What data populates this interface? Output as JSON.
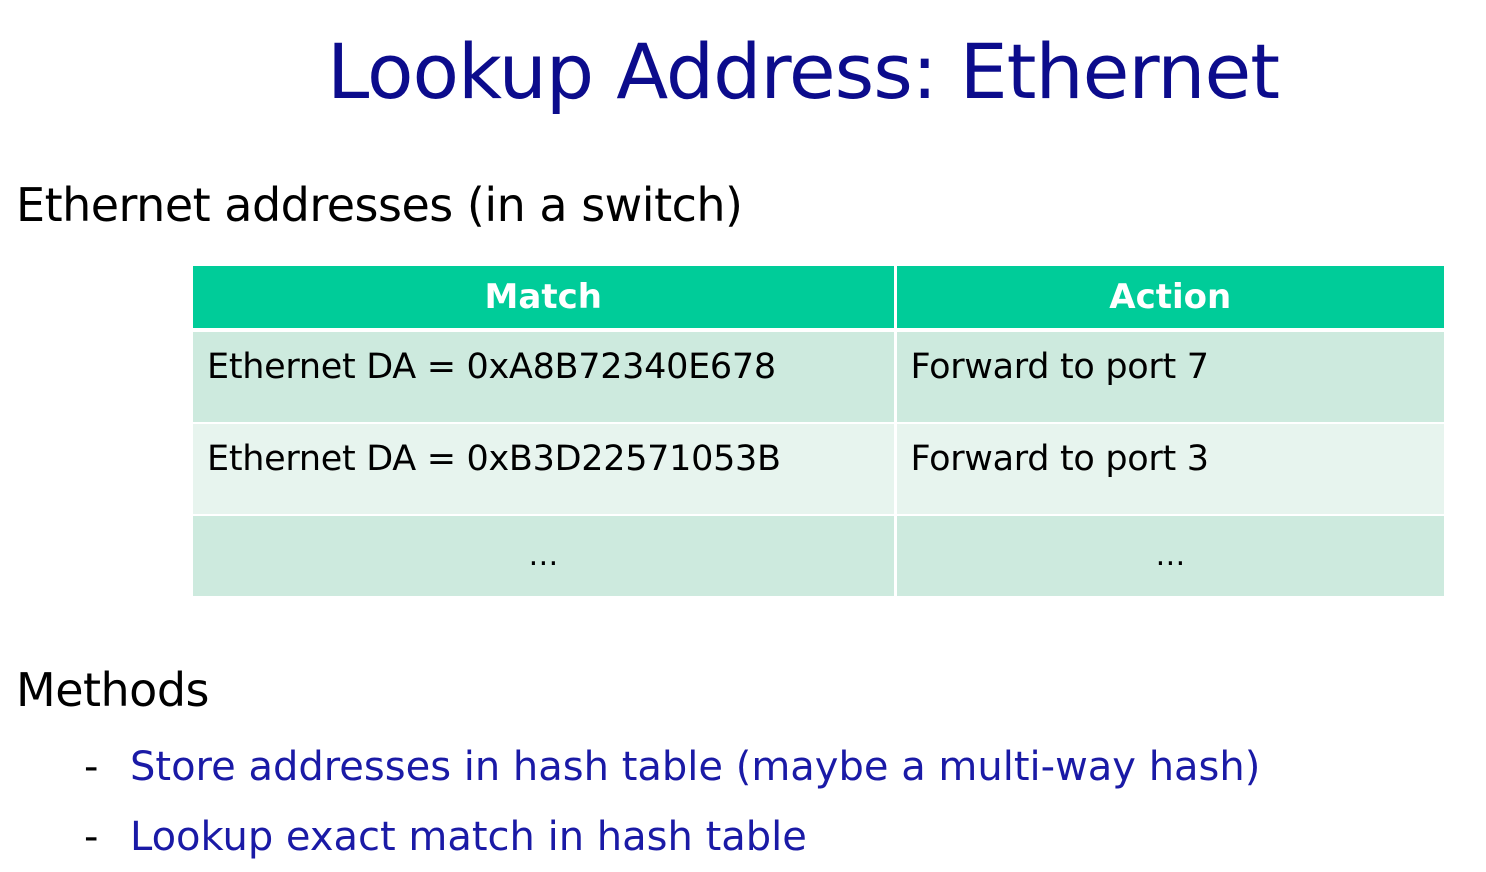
{
  "slide": {
    "title": "Lookup Address: Ethernet",
    "section1": "Ethernet addresses (in a switch)",
    "section2": "Methods"
  },
  "table": {
    "headers": [
      "Match",
      "Action"
    ],
    "rows": [
      [
        "Ethernet DA = 0xA8B72340E678",
        "Forward to port 7"
      ],
      [
        "Ethernet DA = 0xB3D22571053B",
        "Forward to port 3"
      ],
      [
        "…",
        "…"
      ]
    ]
  },
  "methods": {
    "bullet": "-",
    "items": [
      "Store addresses in hash table (maybe a multi-way hash)",
      "Lookup exact match in hash table"
    ]
  },
  "colors": {
    "title": "#0c0c8c",
    "header_bg": "#00cc99",
    "row_dark": "#cdeade",
    "row_light": "#e7f4ee",
    "list_text": "#1a1aa6"
  }
}
